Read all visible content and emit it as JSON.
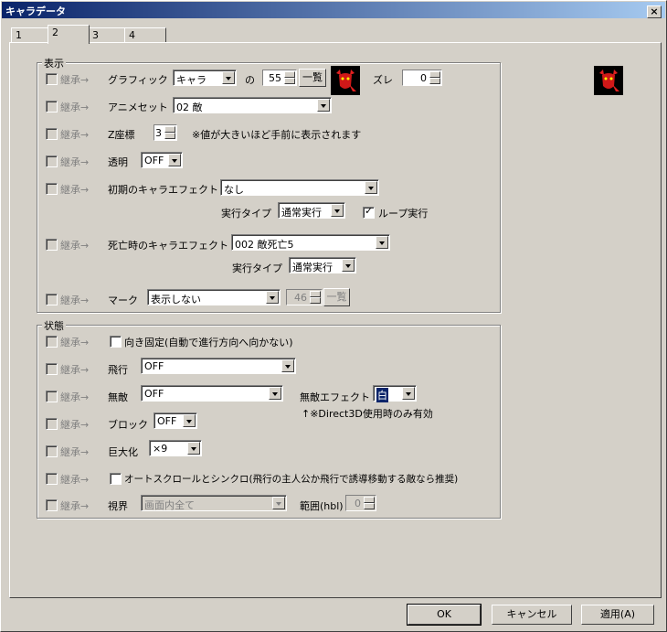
{
  "window": {
    "title": "キャラデータ",
    "close": "×"
  },
  "tabs": [
    "1",
    "2",
    "3",
    "4"
  ],
  "inherit_label": "継承→",
  "display": {
    "group_label": "表示",
    "graphic_label": "グラフィック",
    "graphic_type": "キャラ",
    "no_label": "の",
    "graphic_num": "55",
    "list_btn": "一覧",
    "offset_label": "ズレ",
    "offset_val": "0",
    "anim_label": "アニメセット",
    "anim_val": "02 敵",
    "z_label": "Z座標",
    "z_val": "3",
    "z_note": "※値が大きいほど手前に表示されます",
    "trans_label": "透明",
    "trans_val": "OFF",
    "init_effect_label": "初期のキャラエフェクト",
    "init_effect_val": "なし",
    "exec_type_label": "実行タイプ",
    "exec_type_val": "通常実行",
    "loop_label": "ループ実行",
    "death_effect_label": "死亡時のキャラエフェクト",
    "death_effect_val": "002 敵死亡5",
    "exec_type2_val": "通常実行",
    "mark_label": "マーク",
    "mark_val": "表示しない",
    "mark_num": "46",
    "mark_list_btn": "一覧"
  },
  "state": {
    "group_label": "状態",
    "dir_fix_label": "向き固定(自動で進行方向へ向かない)",
    "fly_label": "飛行",
    "fly_val": "OFF",
    "invinc_label": "無敵",
    "invinc_val": "OFF",
    "invinc_effect_label": "無敵エフェクト",
    "invinc_effect_val": "白",
    "invinc_note": "↑※Direct3D使用時のみ有効",
    "block_label": "ブロック",
    "block_val": "OFF",
    "giant_label": "巨大化",
    "giant_val": "×9",
    "autoscroll_label": "オートスクロールとシンクロ(飛行の主人公か飛行で誘導移動する敵なら推奨)",
    "view_label": "視界",
    "view_val": "画面内全て",
    "range_label": "範囲(hbl)",
    "range_val": "0"
  },
  "buttons": {
    "ok": "OK",
    "cancel": "キャンセル",
    "apply": "適用(A)"
  }
}
